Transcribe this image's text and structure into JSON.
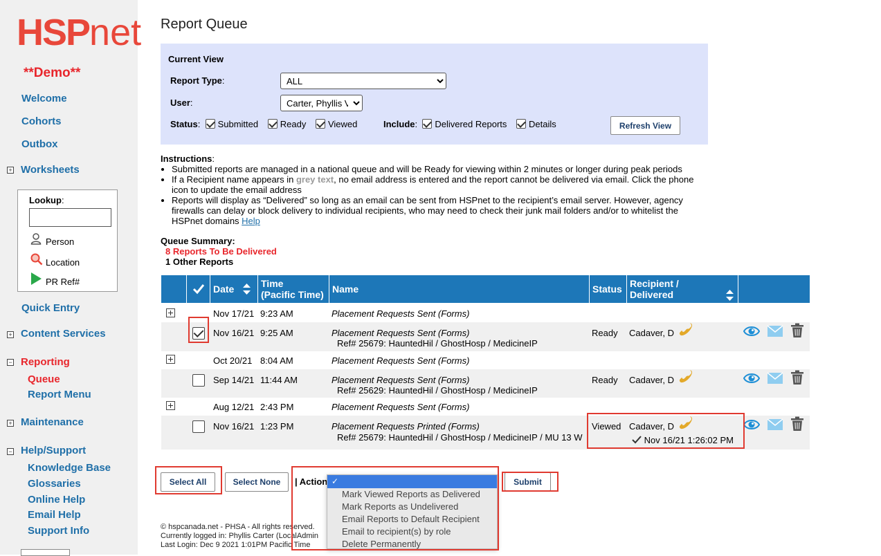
{
  "sidebar": {
    "logo_hsp": "HSP",
    "logo_net": "net",
    "demo": "**Demo**",
    "welcome": "Welcome",
    "cohorts": "Cohorts",
    "outbox": "Outbox",
    "worksheets": "Worksheets",
    "lookup": {
      "label": "Lookup",
      "colon": ":",
      "person": "Person",
      "location": "Location",
      "pr_ref": "PR Ref#"
    },
    "quick_entry": "Quick Entry",
    "content_services": "Content Services",
    "reporting": "Reporting",
    "queue": "Queue",
    "report_menu": "Report Menu",
    "maintenance": "Maintenance",
    "help_support": "Help/Support",
    "knowledge_base": "Knowledge Base",
    "glossaries": "Glossaries",
    "online_help": "Online Help",
    "email_help": "Email Help",
    "support_info": "Support Info"
  },
  "page": {
    "title": "Report Queue"
  },
  "current_view": {
    "heading": "Current View",
    "report_type_label": "Report Type",
    "report_type_value": "ALL",
    "user_label": "User",
    "user_value": "Carter, Phyllis V",
    "status_label": "Status",
    "status_submitted": "Submitted",
    "status_ready": "Ready",
    "status_viewed": "Viewed",
    "include_label": "Include",
    "include_delivered": "Delivered Reports",
    "include_details": "Details",
    "refresh_button": "Refresh View"
  },
  "instructions": {
    "heading": "Instructions",
    "item1": "Submitted reports are managed in a national queue and will be Ready for viewing within 2 minutes or longer during peak periods",
    "item2_a": "If a Recipient name appears in ",
    "item2_grey": "grey text",
    "item2_b": ", no email address is entered and the report cannot be delivered via email. Click the phone icon to update the email address",
    "item3": "Reports will display as “Delivered” so long as an email can be sent from HSPnet to the recipient’s email server. However, agency firewalls can delay or block delivery to individual recipients, who may need to check their junk mail folders and/or to whitelist the HSPnet domains ",
    "item3_link": "Help"
  },
  "queue_summary": {
    "heading": "Queue Summary:",
    "to_deliver": "8 Reports To Be Delivered",
    "other": "1 Other Reports"
  },
  "table": {
    "headers": {
      "date": "Date",
      "time_1": "Time",
      "time_2": "(Pacific Time)",
      "name": "Name",
      "status": "Status",
      "recipient_1": "Recipient /",
      "recipient_2": "Delivered"
    },
    "rows": [
      {
        "date": "Nov 17/21",
        "time": "9:23 AM",
        "name": "Placement Requests Sent (Forms)"
      },
      {
        "date": "Nov 16/21",
        "time": "9:25 AM",
        "name": "Placement Requests Sent (Forms)",
        "ref": "Ref# 25679: HauntedHil / GhostHosp / MedicineIP",
        "status": "Ready",
        "recipient": "Cadaver, D"
      },
      {
        "date": "Oct 20/21",
        "time": "8:04 AM",
        "name": "Placement Requests Sent (Forms)"
      },
      {
        "date": "Sep 14/21",
        "time": "11:44 AM",
        "name": "Placement Requests Sent (Forms)",
        "ref": "Ref# 25629: HauntedHil / GhostHosp / MedicineIP",
        "status": "Ready",
        "recipient": "Cadaver, D"
      },
      {
        "date": "Aug 12/21",
        "time": "2:43 PM",
        "name": "Placement Requests Sent (Forms)"
      },
      {
        "date": "Nov 16/21",
        "time": "1:23 PM",
        "name": "Placement Requests Printed (Forms)",
        "ref": "Ref# 25679: HauntedHil / GhostHosp / MedicineIP / MU 13 W",
        "status": "Viewed",
        "recipient": "Cadaver, D",
        "delivered": "Nov 16/21 1:26:02 PM"
      }
    ]
  },
  "actions": {
    "select_all": "Select All",
    "select_none": "Select None",
    "action_label": "| Action",
    "submit": "Submit",
    "dropdown_selected": "✓",
    "options": [
      "Mark Viewed Reports as Delivered",
      "Mark Reports as Undelivered",
      "Email Reports to Default Recipient",
      "Email to recipient(s) by role",
      "Delete Permanently"
    ]
  },
  "footer": {
    "line1": "© hspcanada.net - PHSA - All rights reserved.",
    "line2": "Currently logged in: Phyllis Carter (LocalAdmin",
    "line3": "Last Login: Dec  9 2021   1:01PM Pacific Time"
  },
  "colors": {
    "brand_red": "#e8473a",
    "nav_blue": "#1f6fa8",
    "table_header_blue": "#1d77b8",
    "panel_bg": "#dde3fb",
    "highlight_box": "#e03a30",
    "phone_gold": "#e3a92a",
    "eye_blue": "#1e8fd6"
  }
}
